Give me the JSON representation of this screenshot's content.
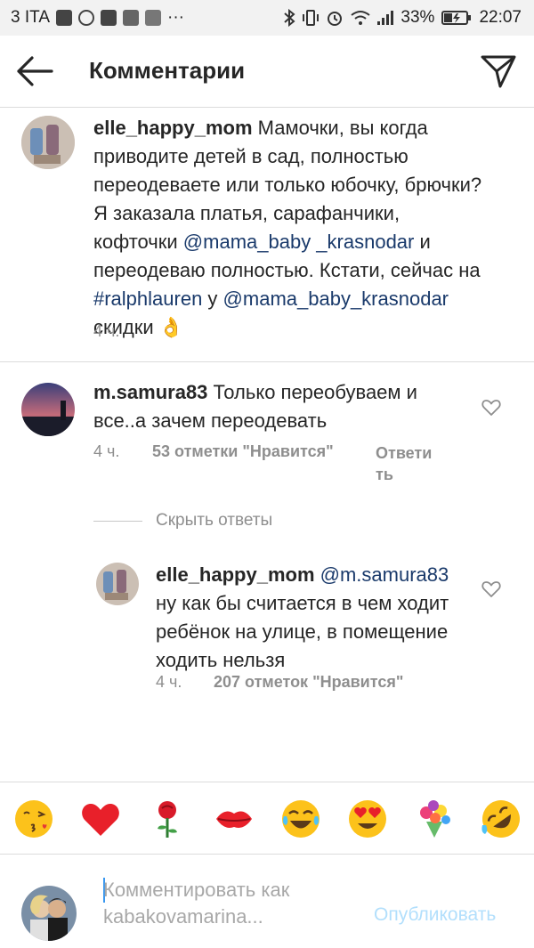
{
  "status_bar": {
    "carrier": "3 ITA",
    "battery": "33%",
    "time": "22:07",
    "more": "···"
  },
  "header": {
    "title": "Комментарии"
  },
  "comments": [
    {
      "username": "elle_happy_mom",
      "parts": [
        {
          "t": "Мамочки, вы когда приводите детей в сад, полностью переодеваете или только юбочку, брючки? Я заказала платья, сарафанчики, кофточки ",
          "k": "text"
        },
        {
          "t": "@mama_baby _krasnodar",
          "k": "mention"
        },
        {
          "t": " и переодеваю полностью. Кстати, сейчас на  ",
          "k": "text"
        },
        {
          "t": "#ralphlauren",
          "k": "tag"
        },
        {
          "t": " у ",
          "k": "text"
        },
        {
          "t": "@mama_baby_krasnodar",
          "k": "mention"
        },
        {
          "t": " скидки 👌",
          "k": "text"
        }
      ],
      "time": "4 ч."
    },
    {
      "username": "m.samura83",
      "text": "Только переобуваем и все..а зачем переодевать",
      "time": "4 ч.",
      "likes": "53 отметки \"Нравится\"",
      "reply": "Ответи ть"
    }
  ],
  "hide_replies": "Скрыть ответы",
  "reply": {
    "username": "elle_happy_mom",
    "mention": "@m.samura83",
    "text": "ну как бы считается в чем ходит ребёнок на улице, в помещение ходить нельзя",
    "time": "4 ч.",
    "likes": "207 отметок \"Нравится\""
  },
  "emoji_bar": [
    "kissing-face",
    "red-heart",
    "rose",
    "kiss-mark",
    "tears-of-joy",
    "heart-eyes",
    "bouquet",
    "rolling-on-floor-laughing"
  ],
  "compose": {
    "placeholder": "Комментировать как kabakovamarina...",
    "publish": "Опубликовать"
  },
  "colors": {
    "mention": "#1a3a6b",
    "meta": "#8e8e8e",
    "publish": "#b2dffc",
    "caret": "#3897f0"
  }
}
